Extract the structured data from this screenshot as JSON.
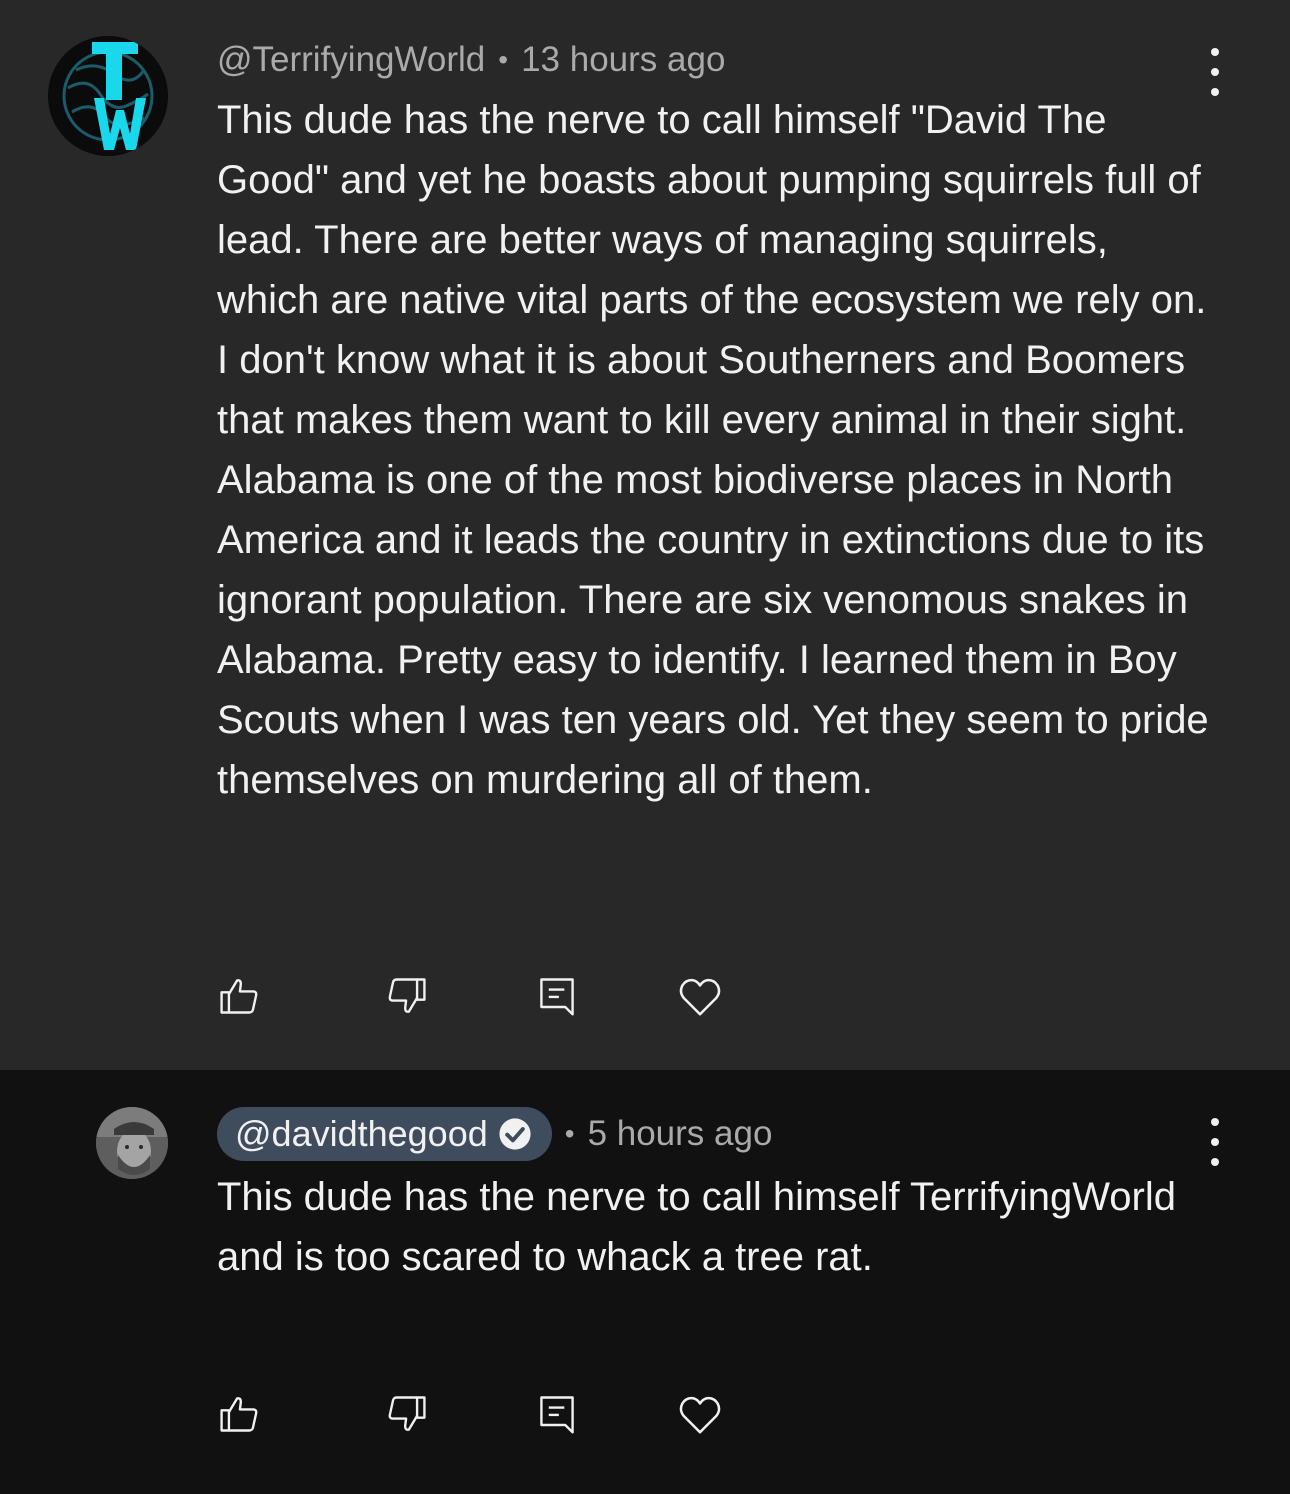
{
  "comments": [
    {
      "author": "@TerrifyingWorld",
      "time": "13 hours ago",
      "separator": "•",
      "avatar_icon": "tw-logo-avatar",
      "text": "This dude has the nerve to call himself \"David The Good\" and yet he boasts about pumping squirrels full of lead. There are better ways of managing squirrels, which are native vital parts of the ecosystem we rely on. I don't know what it is about Southerners and Boomers that makes them want to kill every animal in their sight. Alabama is one of the most biodiverse places in North America and it leads the country in extinctions due to its ignorant population. There are six venomous snakes in Alabama. Pretty easy to identify. I learned them in Boy Scouts when I was ten years old. Yet they seem to pride themselves on murdering all of them.",
      "actions": [
        "thumbs-up-icon",
        "thumbs-down-icon",
        "reply-icon",
        "heart-icon"
      ]
    },
    {
      "author": "@davidthegood",
      "verified": true,
      "time": "5 hours ago",
      "separator": "•",
      "avatar_icon": "user-photo-avatar",
      "text": "This dude has the nerve to call himself TerrifyingWorld and is too scared to whack a tree rat.",
      "actions": [
        "thumbs-up-icon",
        "thumbs-down-icon",
        "reply-icon",
        "heart-icon"
      ]
    }
  ],
  "colors": {
    "top_background": "#282828",
    "reply_background": "#111111",
    "text_primary": "#f1f1f1",
    "text_secondary": "#aaaaaa",
    "author_chip": "#3e4c5e",
    "logo_cyan": "#19d8ec"
  }
}
